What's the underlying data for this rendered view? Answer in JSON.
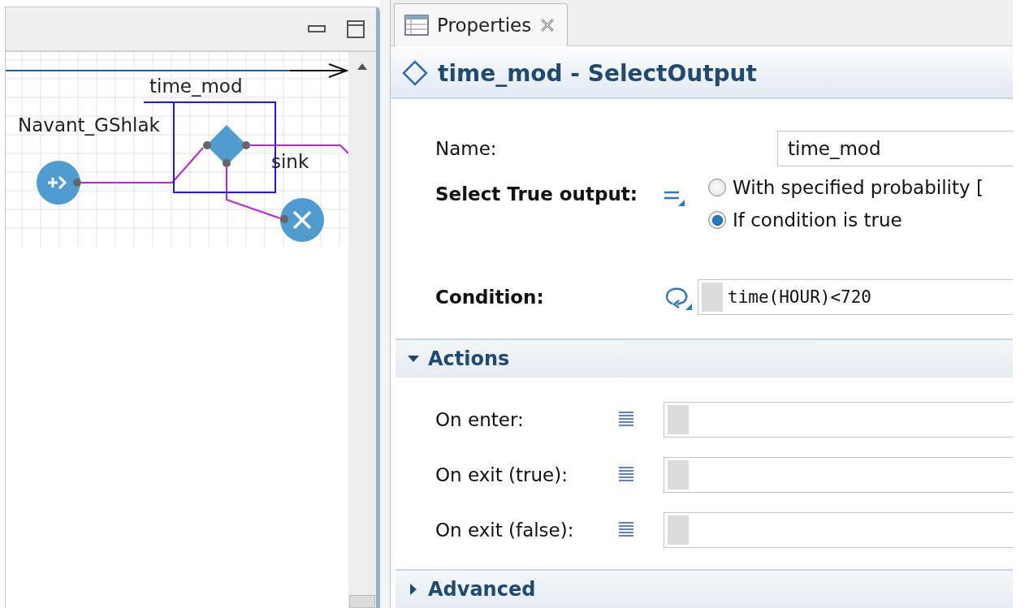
{
  "diagram": {
    "nodes": [
      {
        "kind": "source",
        "label": "Navant_GShlak"
      },
      {
        "kind": "select",
        "label": "time_mod"
      },
      {
        "kind": "sink",
        "label": "sink"
      }
    ]
  },
  "properties": {
    "tab": {
      "label": "Properties",
      "selected": true
    },
    "title": "time_mod - SelectOutput",
    "rows": [
      {
        "kind": "text",
        "label": "Name:",
        "bold": false,
        "value": "time_mod"
      },
      {
        "kind": "radio",
        "label": "Select True output:",
        "bold": true,
        "options": [
          {
            "label": "With specified probability [",
            "selected": false
          },
          {
            "label": "If condition is true",
            "selected": true
          }
        ]
      },
      {
        "kind": "code",
        "label": "Condition:",
        "bold": true,
        "value": "time(HOUR)<720"
      }
    ],
    "sections": [
      {
        "title": "Actions",
        "expanded": true,
        "rows": [
          {
            "label": "On enter:"
          },
          {
            "label": "On exit (true):"
          },
          {
            "label": "On exit (false):"
          }
        ]
      },
      {
        "title": "Advanced",
        "expanded": false
      }
    ]
  }
}
